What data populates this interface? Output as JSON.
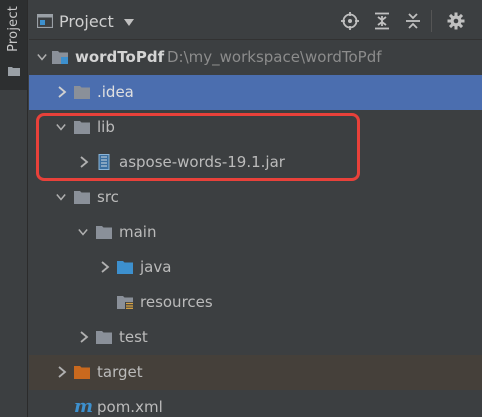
{
  "side_tab": {
    "label": "Project"
  },
  "header": {
    "title": "Project"
  },
  "tree": {
    "root_name": "wordToPdf",
    "root_path": "D:\\my_workspace\\wordToPdf",
    "idea": ".idea",
    "lib": "lib",
    "jar": "aspose-words-19.1.jar",
    "src": "src",
    "main": "main",
    "java": "java",
    "resources": "resources",
    "test": "test",
    "target": "target",
    "pom": "pom.xml"
  },
  "colors": {
    "selection": "#4b6eaf",
    "excluded_bg": "#45403a",
    "highlight": "#e8413a",
    "folder": "#8a9099",
    "source_folder": "#3d90ce",
    "target_folder": "#c9691e"
  },
  "icons": [
    "project-icon",
    "locate-icon",
    "expand-all-icon",
    "collapse-all-icon",
    "gear-icon",
    "folder-icon",
    "module-icon",
    "jar-icon",
    "maven-icon"
  ]
}
